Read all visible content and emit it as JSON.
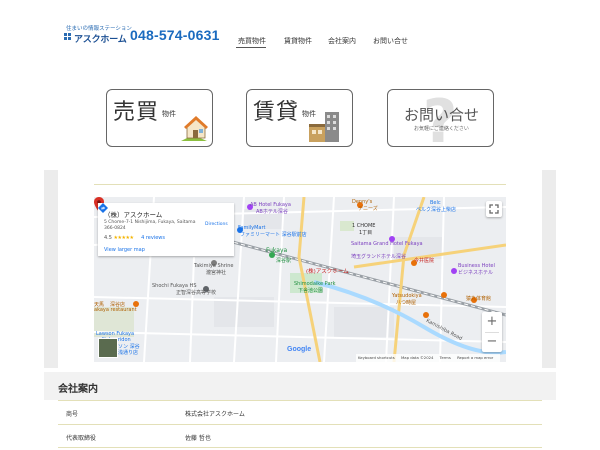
{
  "header": {
    "logo_tagline": "住まいの情報ステーション",
    "logo_name": "アスクホーム",
    "phone": "048-574-0631",
    "nav": [
      {
        "label": "売買物件"
      },
      {
        "label": "賃貸物件"
      },
      {
        "label": "会社案内"
      },
      {
        "label": "お問い合せ"
      }
    ]
  },
  "categories": {
    "sale": {
      "main": "売買",
      "sub": "物件"
    },
    "rent": {
      "main": "賃貸",
      "sub": "物件"
    },
    "contact": {
      "main": "お問い合せ",
      "note": "お気軽にご連絡ください"
    }
  },
  "map": {
    "card": {
      "title": "（株）アスクホーム",
      "address": "5 Chome-7-1 Nishijima, Fukaya, Saitama 366-0824",
      "rating": "4.5",
      "stars": "★★★★★",
      "reviews": "4 reviews",
      "larger_map": "View larger map",
      "directions": "Directions"
    },
    "pin_label": "(株)アスクホーム",
    "labels": {
      "ab_hotel": "AB Hotel Fukaya",
      "ab_hotel_jp": "ABホテル深谷",
      "dennys": "Denny's",
      "dennys_jp": "デニーズ",
      "belc": "Belc",
      "belc_jp": "ベルク深谷上柴店",
      "familymart": "FamilyMart",
      "familymart_jp": "ファミリーマート 深谷駅前店",
      "chome": "1 CHOME",
      "chome_jp": "1丁目",
      "saitama_grand": "Saitama Grand Hotel Fukaya",
      "saitama_grand_jp": "埼玉グランドホテル深谷",
      "fukaya": "Fukaya",
      "takimiya": "Takimiya Shrine",
      "takimiya_jp": "瀧宮神社",
      "imai": "今井医院",
      "business_hotel": "Business Hotel",
      "business_hotel_jp": "ビジネスホテル",
      "shimodaike": "Shimodaike Park",
      "shimodaike_jp": "下舎池公園",
      "shochi": "Shochi Fukaya HS",
      "shochi_jp": "正智深谷高等学校",
      "yatsudokiya": "Yatsudokiya",
      "yatsudokiya_jp": "八つ時屋",
      "tenba": "天馬",
      "fukaya_rest": "深谷店",
      "restaurant": "akaya restaurant",
      "lawson": "Lawson Fukaya",
      "lawson2": "Nakauridon",
      "lawson_jp": "ソン 深谷",
      "lawson_jp2": "浅通り店",
      "kiyosato_rd": "Kamishiba Road",
      "gym": "猿丸体育館",
      "station_jp": "深谷駅"
    },
    "zoom_in": "+",
    "zoom_out": "−",
    "google": "Google",
    "footer": [
      "Keyboard shortcuts",
      "Map data ©2024",
      "Terms",
      "Report a map error"
    ]
  },
  "company": {
    "title": "会社案内",
    "rows": [
      {
        "key": "商号",
        "value": "株式会社アスクホーム"
      },
      {
        "key": "代表取締役",
        "value": "佐藤 哲也"
      }
    ]
  },
  "colors": {
    "accent_blue": "#1b6bbf",
    "logo_blue": "#2a6cb3",
    "section_line": "#e3e0b8",
    "map_pin": "#d93025"
  }
}
